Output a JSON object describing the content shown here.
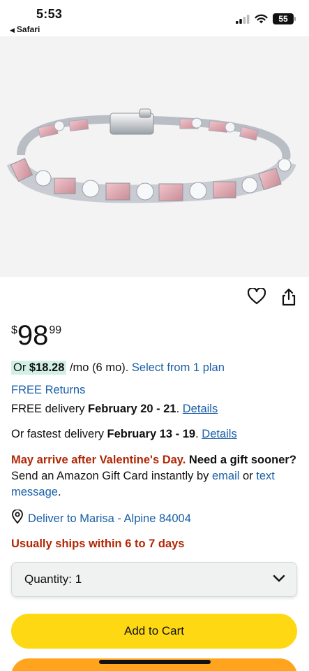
{
  "status_bar": {
    "time": "5:53",
    "back_app": "Safari",
    "battery": "55"
  },
  "product": {
    "image_icon": "bracelet-image"
  },
  "actions": {
    "wishlist_icon": "heart-icon",
    "share_icon": "share-icon"
  },
  "price": {
    "currency": "$",
    "whole": "98",
    "fraction": "99"
  },
  "installment": {
    "prefix": "Or ",
    "amount": "$18.28",
    "term": " /mo (6 mo). ",
    "plan_link": "Select from 1 plan"
  },
  "returns": {
    "label": "FREE Returns"
  },
  "delivery": {
    "free_prefix": "FREE delivery ",
    "free_dates": "February 20 - 21",
    "free_sep": ". ",
    "free_details": "Details",
    "fast_prefix": "Or fastest delivery ",
    "fast_dates": "February 13 - 19",
    "fast_sep": ". ",
    "fast_details": "Details"
  },
  "gift_notice": {
    "warning": "May arrive after Valentine's Day.",
    "question": " Need a gift sooner?",
    "text": " Send an Amazon Gift Card instantly by ",
    "email_link": "email",
    "or": " or ",
    "text_link": "text message",
    "end": "."
  },
  "deliver_to": {
    "label": "Deliver to Marisa - Alpine 84004"
  },
  "availability": {
    "label": "Usually ships within 6 to 7 days"
  },
  "quantity": {
    "label": "Quantity: ",
    "value": "1"
  },
  "buttons": {
    "add_to_cart": "Add to Cart"
  },
  "colors": {
    "link": "#1a5fa8",
    "alert": "#b12704",
    "add_to_cart": "#ffd814",
    "buy_now": "#ffa41c",
    "highlight": "#d2efe6"
  }
}
